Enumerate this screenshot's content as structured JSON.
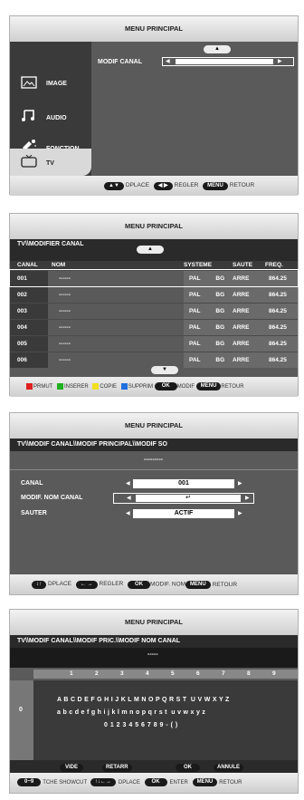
{
  "panel1": {
    "header": "MENU PRINCIPAL",
    "sidebar": [
      {
        "label": "IMAGE",
        "icon": "image-icon"
      },
      {
        "label": "AUDIO",
        "icon": "music-note-icon"
      },
      {
        "label": "FONCTION",
        "icon": "function-icon"
      },
      {
        "label": "TV",
        "icon": "tv-icon"
      }
    ],
    "setting_label": "MODIF CANAL",
    "footer": {
      "arrows_ud": "▲▼",
      "deplace": "DPLACE",
      "arrows_lr": "◀ ▶",
      "regler": "REGLER",
      "menu": "MENU",
      "retour": "RETOUR"
    }
  },
  "panel2": {
    "header": "MENU PRINCIPAL",
    "path": "TV\\\\MODIFIER CANAL",
    "columns": [
      "CANAL",
      "NOM",
      "SYSTEME",
      "",
      "SAUTE",
      "FREQ."
    ],
    "rows": [
      {
        "canal": "001",
        "nom": "------",
        "sys1": "PAL",
        "sys2": "BG",
        "saute": "ARRE",
        "freq": "864.25"
      },
      {
        "canal": "002",
        "nom": "------",
        "sys1": "PAL",
        "sys2": "BG",
        "saute": "ARRE",
        "freq": "864.25"
      },
      {
        "canal": "003",
        "nom": "------",
        "sys1": "PAL",
        "sys2": "BG",
        "saute": "ARRE",
        "freq": "864.25"
      },
      {
        "canal": "004",
        "nom": "------",
        "sys1": "PAL",
        "sys2": "BG",
        "saute": "ARRE",
        "freq": "864.25"
      },
      {
        "canal": "005",
        "nom": "------",
        "sys1": "PAL",
        "sys2": "BG",
        "saute": "ARRE",
        "freq": "864.25"
      },
      {
        "canal": "006",
        "nom": "------",
        "sys1": "PAL",
        "sys2": "BG",
        "saute": "ARRE",
        "freq": "864.25"
      }
    ],
    "footer": {
      "prmut": "PRMUT",
      "inserer": "INSERER",
      "copie": "COPIE",
      "supprim": "SUPPRIM",
      "ok": "OK",
      "modif": "MODIF",
      "menu": "MENU",
      "retour": "RETOUR"
    },
    "colors": {
      "red": "#e02020",
      "green": "#20b020",
      "yellow": "#f0e020",
      "blue": "#2070e0"
    }
  },
  "panel3": {
    "header": "MENU PRINCIPAL",
    "path": "TV\\\\MODIF CANAL\\\\MODIF PRINCIPAL\\\\MODIF SO",
    "dashes": "---------",
    "canal_label": "CANAL",
    "canal_value": "001",
    "nom_label": "MODIF. NOM CANAL",
    "sauter_label": "SAUTER",
    "sauter_value": "ACTIF",
    "footer": {
      "ud": "↕↑",
      "deplace": "DPLACE",
      "lr": "← →",
      "regler": "REGLER",
      "ok": "OK",
      "modif": "MODIF. NOM",
      "menu": "MENU",
      "retour": "RETOUR"
    }
  },
  "panel4": {
    "header": "MENU PRINCIPAL",
    "path": "TV\\\\MODIF CANAL\\\\MODIF PRIC.\\\\MODIF NOM CANAL",
    "name_value": "-----",
    "numbers": [
      "1",
      "2",
      "3",
      "4",
      "5",
      "6",
      "7",
      "8",
      "9"
    ],
    "zero": "0",
    "upper": "A B C D E F G H I J K L M N O P Q R S T  U V W X Y Z",
    "lower": "a b c d e f g h i j k l m n o p q r s t  u v w x y z",
    "digits": "0 1 2 3 4 5 6 7 8 9 - ( )",
    "buttons": [
      "VIDE",
      "RETARR",
      "OK",
      "ANNULE"
    ],
    "footer": {
      "digits_key": "0~9",
      "tche": "TCHE SHOWCUT",
      "arrows": "↑↓←→",
      "deplace": "DPLACE",
      "ok": "OK",
      "enter": "ENTER",
      "menu": "MENU",
      "retour": "RETOUR"
    }
  }
}
